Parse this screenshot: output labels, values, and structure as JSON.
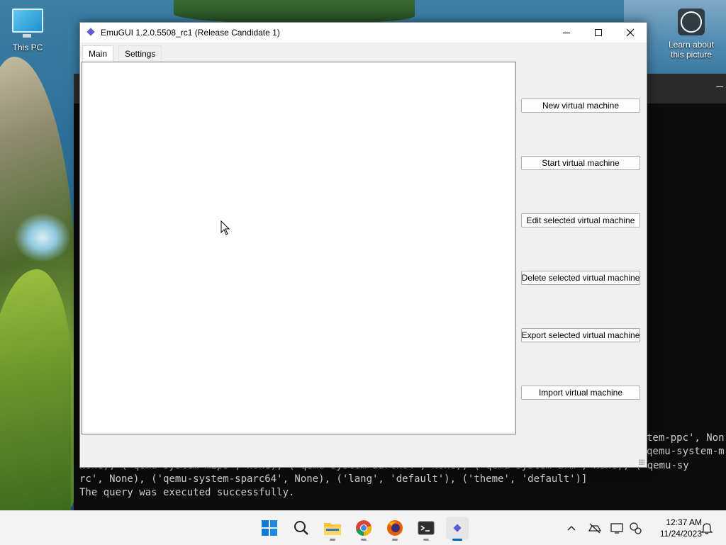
{
  "desktop": {
    "icons": [
      {
        "label": "This PC"
      },
      {
        "label": "Learn about this picture"
      }
    ]
  },
  "terminal": {
    "lines": [
      "tem-ppc', Non",
      "qemu-system-m",
      "None), ('qemu-system-mips', None), ('qemu-system-aarch64', None), ('qemu-system-arm', None), ('qemu-sy",
      "rc', None), ('qemu-system-sparc64', None), ('lang', 'default'), ('theme', 'default')]",
      "The query was executed successfully."
    ]
  },
  "window": {
    "title": "EmuGUI 1.2.0.5508_rc1 (Release Candidate 1)",
    "tabs": [
      {
        "label": "Main",
        "selected": true
      },
      {
        "label": "Settings",
        "selected": false
      }
    ],
    "buttons": [
      {
        "label": "New virtual machine"
      },
      {
        "label": "Start virtual machine"
      },
      {
        "label": "Edit selected virtual machine"
      },
      {
        "label": "Delete selected virtual machine"
      },
      {
        "label": "Export selected virtual machine"
      },
      {
        "label": "Import virtual machine"
      }
    ],
    "controls": {
      "minimize": "minimize-icon",
      "maximize": "maximize-icon",
      "close": "close-icon"
    }
  },
  "taskbar": {
    "apps": [
      "windows-start-icon",
      "search-icon",
      "file-explorer-icon",
      "chrome-icon",
      "firefox-icon",
      "terminal-icon",
      "emugui-icon"
    ],
    "active_app": "emugui-icon",
    "tray_icons": [
      "chevron-up-icon",
      "network-offline-icon",
      "display-icon",
      "settings-sync-icon"
    ],
    "time": "12:37 AM",
    "date": "11/24/2023",
    "accent": "#0067c0"
  }
}
